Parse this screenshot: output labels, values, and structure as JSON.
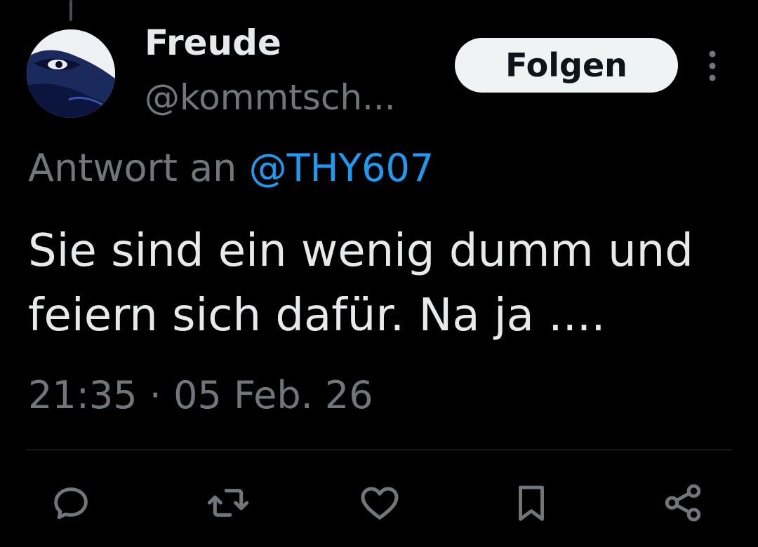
{
  "tweet": {
    "author": {
      "display_name": "Freude",
      "handle": "@kommtsch..."
    },
    "follow_label": "Folgen",
    "reply_to": {
      "prefix": "Antwort an",
      "mention": "@THY607"
    },
    "text": "Sie sind ein wenig dumm und feiern sich dafür. Na ja ....",
    "timestamp": "21:35 · 05 Feb. 26"
  },
  "actions": [
    {
      "name": "reply",
      "icon": "reply-icon"
    },
    {
      "name": "retweet",
      "icon": "retweet-icon"
    },
    {
      "name": "like",
      "icon": "heart-icon"
    },
    {
      "name": "bookmark",
      "icon": "bookmark-icon"
    },
    {
      "name": "share",
      "icon": "share-icon"
    }
  ],
  "colors": {
    "background": "#000000",
    "text": "#e7e9ea",
    "secondary_text": "#71767b",
    "accent": "#1d9bf0",
    "follow_button_bg": "#eff3f4",
    "divider": "#2f3336"
  }
}
